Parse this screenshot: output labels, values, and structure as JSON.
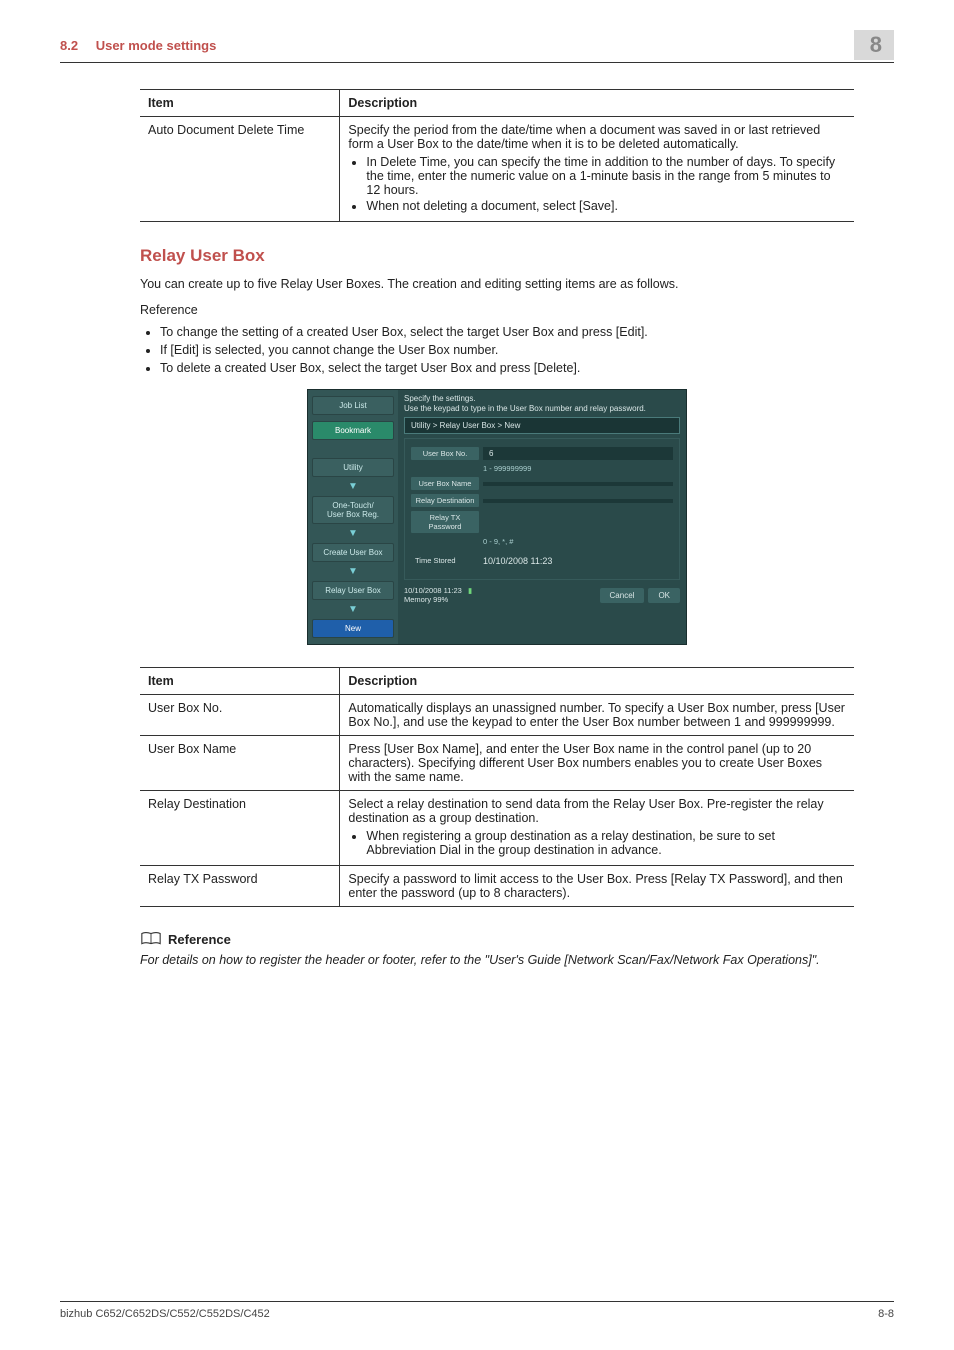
{
  "header": {
    "section_num": "8.2",
    "section_title": "User mode settings",
    "chapter": "8"
  },
  "table1": {
    "h_item": "Item",
    "h_desc": "Description",
    "row1_item": "Auto Document Delete Time",
    "row1_desc_main": "Specify the period from the date/time when a document was saved in or last retrieved form a User Box to the date/time when it is to be deleted automatically.",
    "row1_b1": "In Delete Time, you can specify the time in addition to the number of days. To specify the time, enter the numeric value on a 1-minute basis in the range from 5 minutes to 12 hours.",
    "row1_b2": "When not deleting a document, select [Save]."
  },
  "relay": {
    "heading": "Relay User Box",
    "intro": "You can create up to five Relay User Boxes. The creation and editing setting items are as follows.",
    "ref_label": "Reference",
    "b1": "To change the setting of a created User Box, select the target User Box and press [Edit].",
    "b2": "If [Edit] is selected, you cannot change the User Box number.",
    "b3": "To delete a created User Box, select the target User Box and press [Delete]."
  },
  "panel": {
    "joblist": "Job List",
    "bookmark": "Bookmark",
    "utility": "Utility",
    "onetouch": "One-Touch/\nUser Box Reg.",
    "createbox": "Create User Box",
    "relaybox": "Relay User Box",
    "new": "New",
    "topline1": "Specify the settings.",
    "topline2": "Use the keypad to type in the User Box number and relay password.",
    "crumb": "Utility > Relay User Box > New",
    "l_boxno": "User Box No.",
    "v_boxno": "6",
    "range": "1  -  999999999",
    "l_boxname": "User Box Name",
    "l_relaydest": "Relay Destination",
    "l_relaypw": "Relay TX Password",
    "keypad": "0  -  9, *, #",
    "l_time": "Time Stored",
    "v_time": "10/10/2008  11:23",
    "f_date": "10/10/2008    11:23",
    "f_mem": "Memory        99%",
    "cancel": "Cancel",
    "ok": "OK"
  },
  "table2": {
    "h_item": "Item",
    "h_desc": "Description",
    "r1_item": "User Box No.",
    "r1_desc": "Automatically displays an unassigned number. To specify a User Box number, press [User Box No.], and use the keypad to enter the User Box number between 1 and 999999999.",
    "r2_item": "User Box Name",
    "r2_desc": "Press [User Box Name], and enter the User Box name in the control panel (up to 20 characters). Specifying different User Box numbers enables you to create User Boxes with the same name.",
    "r3_item": "Relay Destination",
    "r3_desc_main": "Select a relay destination to send data from the Relay User Box. Pre-register the relay destination as a group destination.",
    "r3_b1": "When registering a group destination as a relay destination, be sure to set Abbreviation Dial in the group destination in advance.",
    "r4_item": "Relay TX Password",
    "r4_desc": "Specify a password to limit access to the User Box. Press [Relay TX Password], and then enter the password (up to 8 characters)."
  },
  "refnote": {
    "label": "Reference",
    "text": "For details on how to register the header or footer, refer to the \"User's Guide [Network Scan/Fax/Network Fax Operations]\"."
  },
  "footer": {
    "model": "bizhub C652/C652DS/C552/C552DS/C452",
    "page": "8-8"
  }
}
